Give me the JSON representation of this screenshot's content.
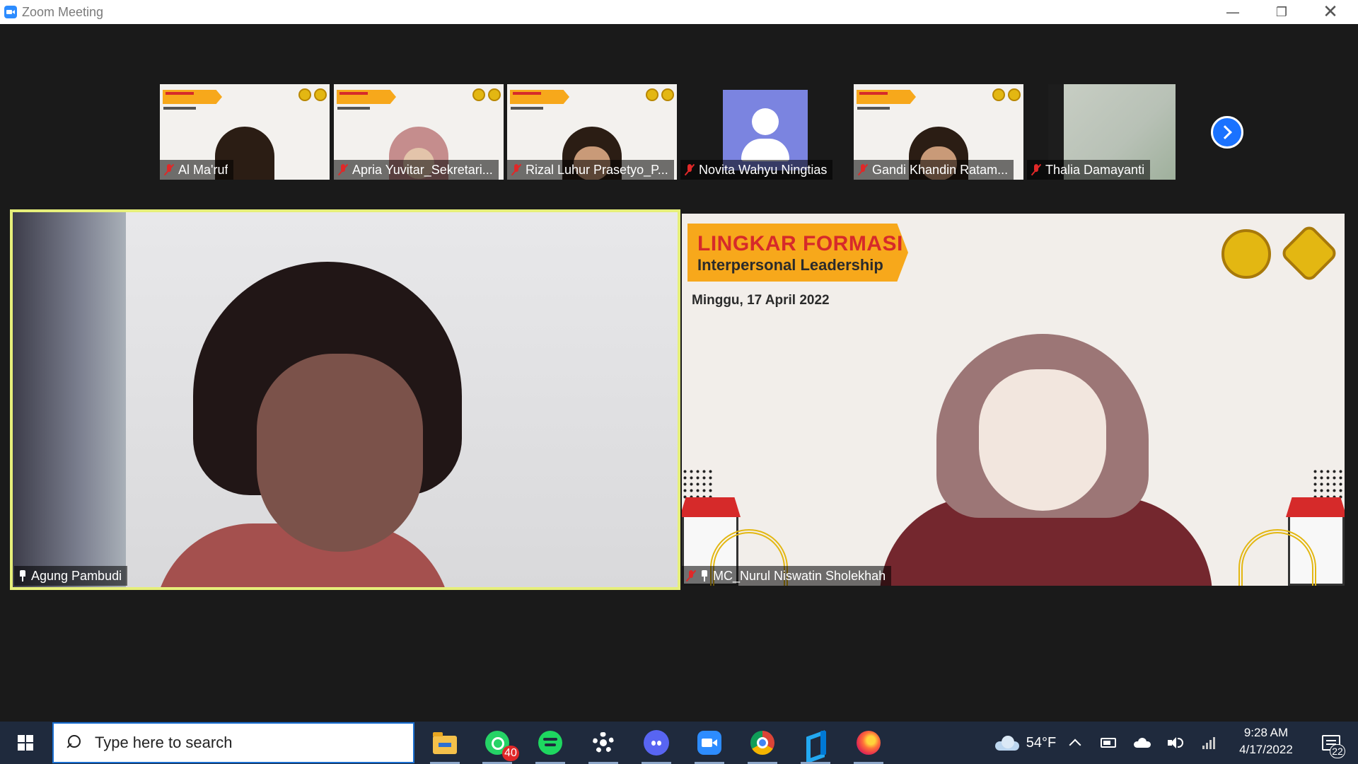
{
  "window": {
    "title": "Zoom Meeting",
    "controls": [
      "minimize",
      "restore",
      "close"
    ]
  },
  "gallery_strip": {
    "participants": [
      {
        "name": "Al Ma'ruf",
        "muted": true,
        "video": "slide-person"
      },
      {
        "name": "Apria Yuvitar_Sekretari...",
        "muted": true,
        "video": "slide-hijab"
      },
      {
        "name": "Rizal Luhur Prasetyo_P...",
        "muted": true,
        "video": "slide-person"
      },
      {
        "name": "Novita Wahyu Ningtias",
        "muted": true,
        "video": "avatar"
      },
      {
        "name": "Gandi Khandin Ratam...",
        "muted": true,
        "video": "slide-person"
      },
      {
        "name": "Thalia Damayanti",
        "muted": true,
        "video": "camera"
      }
    ],
    "next_page_icon": "chevron-right-icon"
  },
  "main_tiles": {
    "left": {
      "name": "Agung Pambudi",
      "pinned": true,
      "active_speaker": true
    },
    "right": {
      "name": "MC_Nurul Niswatin Sholekhah",
      "muted": true,
      "pinned": true,
      "slide": {
        "title": "LINGKAR FORMASI",
        "subtitle": "Interpersonal Leadership",
        "date": "Minggu, 17 April 2022"
      }
    }
  },
  "taskbar": {
    "search_placeholder": "Type here to search",
    "apps": [
      {
        "name": "File Explorer",
        "icon": "folder-icon",
        "running": true
      },
      {
        "name": "WhatsApp",
        "icon": "whatsapp-icon",
        "badge": "40",
        "running": true
      },
      {
        "name": "Spotify",
        "icon": "spotify-icon",
        "running": true
      },
      {
        "name": "Settings",
        "icon": "gear-icon",
        "running": true
      },
      {
        "name": "Discord",
        "icon": "discord-icon",
        "running": true
      },
      {
        "name": "Zoom",
        "icon": "zoom-icon",
        "running": true
      },
      {
        "name": "Chrome",
        "icon": "chrome-icon",
        "running": true
      },
      {
        "name": "VS Code",
        "icon": "vscode-icon",
        "running": true
      },
      {
        "name": "Firefox",
        "icon": "firefox-icon",
        "running": true
      }
    ],
    "weather": "54°F",
    "time": "9:28 AM",
    "date": "4/17/2022",
    "notifications": "22"
  },
  "colors": {
    "accent": "#2d8cff",
    "active_speaker_border": "#e6ef7a",
    "muted_mic": "#e02828",
    "taskbar": "#1f2a3d",
    "slide_banner": "#f7a81b",
    "slide_title": "#d62a2a"
  }
}
